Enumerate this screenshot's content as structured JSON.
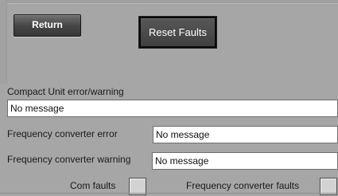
{
  "buttons": {
    "return_label": "Return",
    "reset_faults_label": "Reset Faults"
  },
  "compact_unit": {
    "label": "Compact Unit error/warning",
    "value": "No message"
  },
  "frequency_converter_error": {
    "label": "Frequency converter error",
    "value": "No message"
  },
  "frequency_converter_warning": {
    "label": "Frequency converter warning",
    "value": "No message"
  },
  "faults": {
    "com_label": "Com faults",
    "freq_conv_label": "Frequency converter faults"
  }
}
